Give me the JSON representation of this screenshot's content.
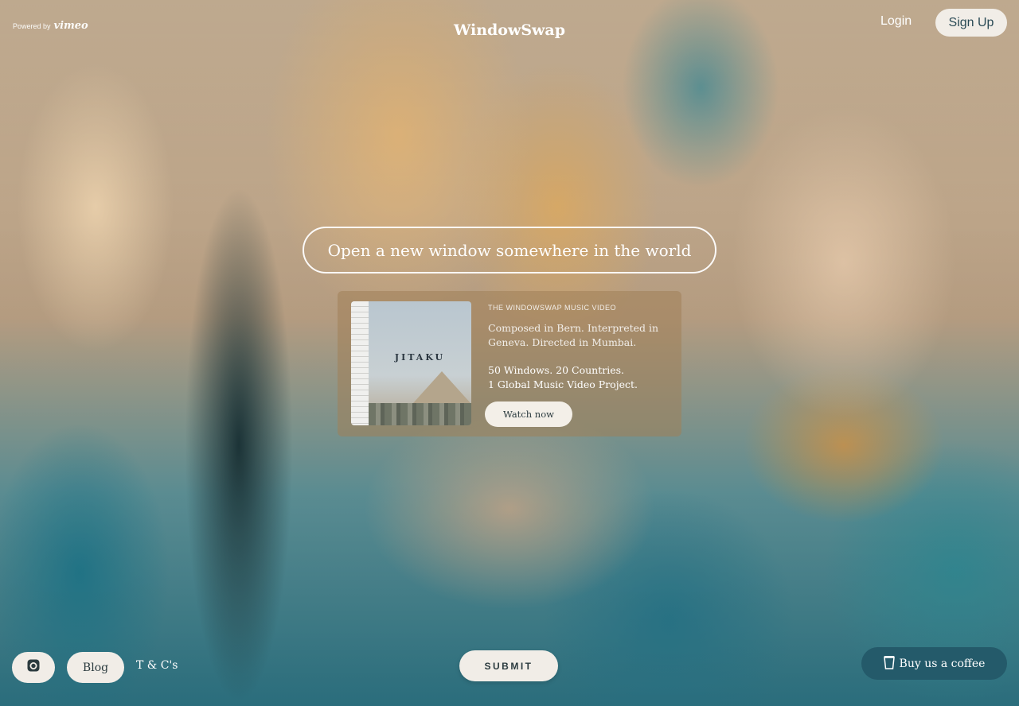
{
  "header": {
    "powered_by": "Powered by",
    "vimeo": "vimeo",
    "brand": "WindowSwap",
    "login": "Login",
    "signup": "Sign Up"
  },
  "main": {
    "open_window": "Open a new window somewhere in the world"
  },
  "promo": {
    "thumbnail_title": "JITAKU",
    "kicker": "THE WINDOWSWAP MUSIC VIDEO",
    "description": "Composed in Bern. Interpreted in Geneva. Directed in Mumbai.",
    "headline_line1": "50 Windows. 20 Countries.",
    "headline_line2": "1 Global Music Video Project.",
    "watch_now": "Watch now"
  },
  "footer": {
    "instagram_icon": "instagram-icon",
    "blog": "Blog",
    "terms": "T & C's",
    "submit": "SUBMIT",
    "coffee_icon": "coffee-cup-icon",
    "coffee": "Buy us a coffee"
  },
  "colors": {
    "accent_dark": "#245a6a",
    "button_light": "#f1ede7",
    "text_dark": "#2b3b3f"
  }
}
